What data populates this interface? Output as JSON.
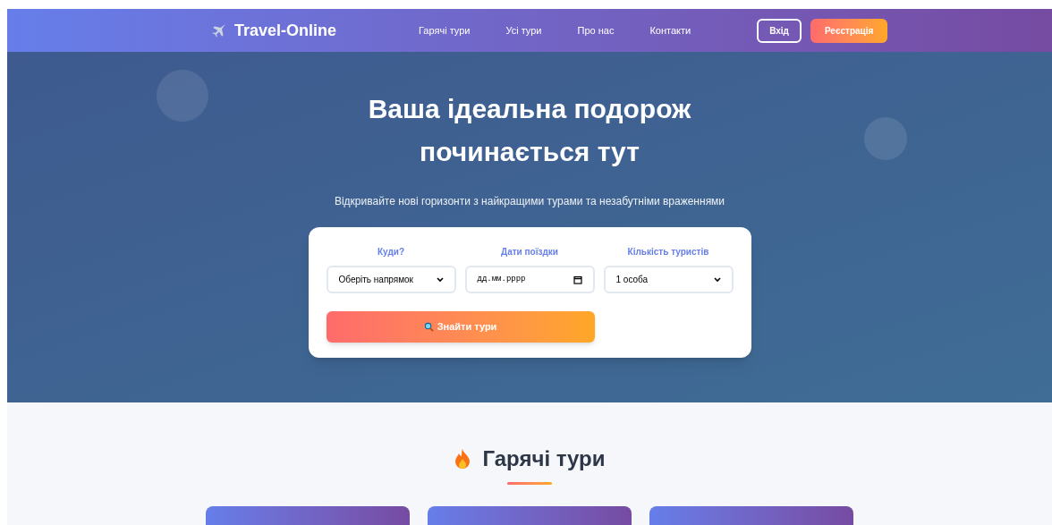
{
  "brand": {
    "name": "Travel-Online"
  },
  "nav": [
    {
      "label": "Гарячі тури"
    },
    {
      "label": "Усі тури"
    },
    {
      "label": "Про нас"
    },
    {
      "label": "Контакти"
    }
  ],
  "auth": {
    "login": "Вхід",
    "register": "Реєстрація"
  },
  "hero": {
    "title_lines": [
      "Ваша ідеальна подорож",
      "починається тут"
    ],
    "subtitle": "Відкривайте нові горизонти з найкращими турами та незабутніми враженнями"
  },
  "search": {
    "fields": [
      {
        "kind": "select",
        "label": "Куди?",
        "value": "Оберіть напрямок"
      },
      {
        "kind": "date",
        "label": "Дати поїздки",
        "placeholder": "дд.мм.рррр"
      },
      {
        "kind": "select",
        "label": "Кількість туристів",
        "value": "1 особа"
      }
    ],
    "button": "Знайти тури"
  },
  "hot": {
    "title": "Гарячі тури",
    "cards": [
      {
        "kind": "tour"
      },
      {
        "kind": "tour"
      },
      {
        "kind": "tour"
      }
    ]
  }
}
